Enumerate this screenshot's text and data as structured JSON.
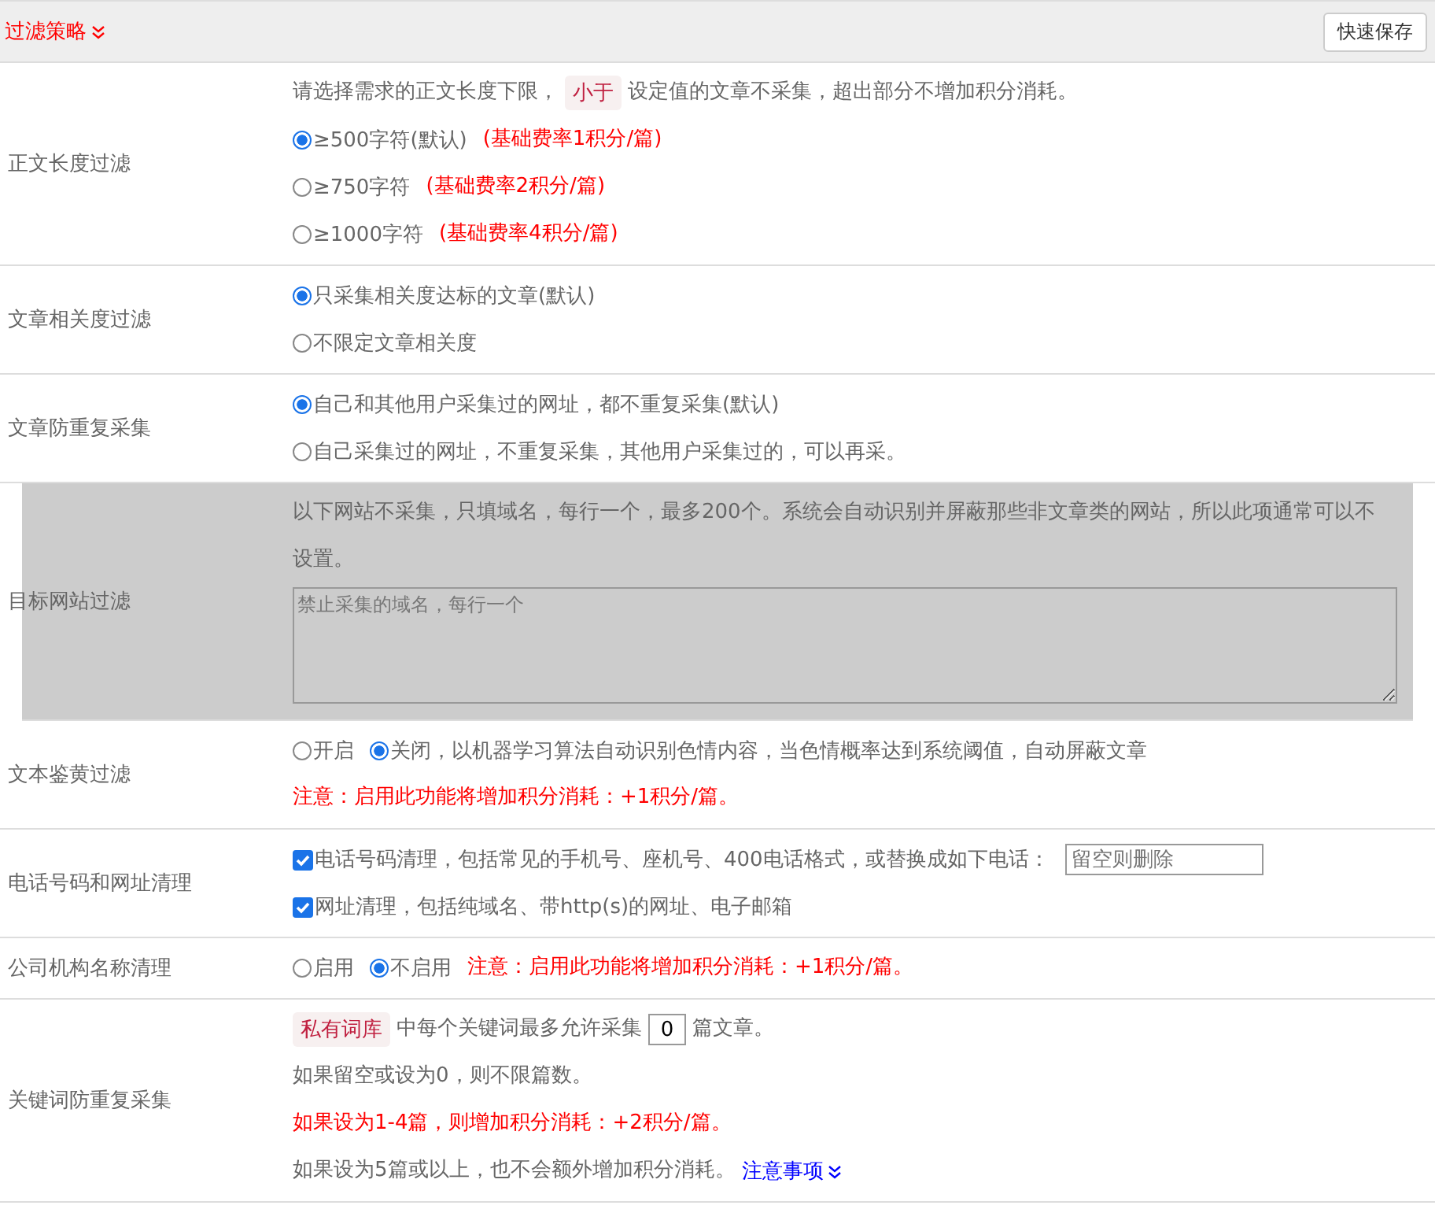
{
  "header": {
    "title": "过滤策略",
    "save_button": "快速保存"
  },
  "rows": [
    {
      "label": "正文长度过滤",
      "shaded": false,
      "lines": [
        [
          {
            "kind": "text",
            "text": "请选择需求的正文长度下限，"
          },
          {
            "kind": "tag",
            "text": "小于"
          },
          {
            "kind": "text",
            "text": "设定值的文章不采集，超出部分不增加积分消耗。"
          }
        ],
        [
          {
            "kind": "radio",
            "text": "≥500字符(默认)",
            "selected": true
          },
          {
            "kind": "warning",
            "text": "(基础费率1积分/篇)"
          }
        ],
        [
          {
            "kind": "radio",
            "text": "≥750字符",
            "selected": false
          },
          {
            "kind": "warning",
            "text": "(基础费率2积分/篇)"
          }
        ],
        [
          {
            "kind": "radio",
            "text": "≥1000字符",
            "selected": false
          },
          {
            "kind": "warning",
            "text": "(基础费率4积分/篇)"
          }
        ]
      ]
    },
    {
      "label": "文章相关度过滤",
      "shaded": false,
      "lines": [
        [
          {
            "kind": "radio",
            "text": "只采集相关度达标的文章(默认)",
            "selected": true
          }
        ],
        [
          {
            "kind": "radio",
            "text": "不限定文章相关度",
            "selected": false
          }
        ]
      ]
    },
    {
      "label": "文章防重复采集",
      "shaded": false,
      "lines": [
        [
          {
            "kind": "radio",
            "text": "自己和其他用户采集过的网址，都不重复采集(默认)",
            "selected": true
          }
        ],
        [
          {
            "kind": "radio",
            "text": "自己采集过的网址，不重复采集，其他用户采集过的，可以再采。",
            "selected": false
          }
        ]
      ]
    },
    {
      "label": "目标网站过滤",
      "shaded": true,
      "lines": [
        [
          {
            "kind": "text",
            "text": "以下网站不采集，只填域名，每行一个，最多200个。系统会自动识别并屏蔽那些非文章类的网站，所以此项通常可以不设置。"
          }
        ],
        [
          {
            "kind": "textarea",
            "placeholder": "禁止采集的域名，每行一个"
          }
        ]
      ]
    },
    {
      "label": "文本鉴黄过滤",
      "shaded": false,
      "lines": [
        [
          {
            "kind": "radio",
            "text": "开启",
            "selected": false
          },
          {
            "kind": "radio",
            "text": "关闭，以机器学习算法自动识别色情内容，当色情概率达到系统阈值，自动屏蔽文章",
            "selected": true
          }
        ],
        [
          {
            "kind": "warning",
            "text": "注意：启用此功能将增加积分消耗：+1积分/篇。"
          }
        ]
      ]
    },
    {
      "label": "电话号码和网址清理",
      "shaded": false,
      "lines": [
        [
          {
            "kind": "checkbox",
            "text": "电话号码清理，包括常见的手机号、座机号、400电话格式，或替换成如下电话：",
            "checked": true
          },
          {
            "kind": "input",
            "placeholder": "留空则删除"
          }
        ],
        [
          {
            "kind": "checkbox",
            "text": "网址清理，包括纯域名、带http(s)的网址、电子邮箱",
            "checked": true
          }
        ]
      ]
    },
    {
      "label": "公司机构名称清理",
      "shaded": false,
      "lines": [
        [
          {
            "kind": "radio",
            "text": "启用",
            "selected": false
          },
          {
            "kind": "radio",
            "text": "不启用",
            "selected": true
          },
          {
            "kind": "warning",
            "text": "注意：启用此功能将增加积分消耗：+1积分/篇。"
          }
        ]
      ]
    },
    {
      "label": "关键词防重复采集",
      "shaded": false,
      "lines": [
        [
          {
            "kind": "tag",
            "text": "私有词库"
          },
          {
            "kind": "text",
            "text": "中每个关键词最多允许采集"
          },
          {
            "kind": "number",
            "value": "0"
          },
          {
            "kind": "text",
            "text": "篇文章。"
          }
        ],
        [
          {
            "kind": "text",
            "text": "如果留空或设为0，则不限篇数。"
          }
        ],
        [
          {
            "kind": "warning",
            "text": "如果设为1-4篇，则增加积分消耗：+2积分/篇。"
          }
        ],
        [
          {
            "kind": "text",
            "text": "如果设为5篇或以上，也不会额外增加积分消耗。"
          },
          {
            "kind": "link",
            "text": "注意事项"
          }
        ]
      ]
    }
  ]
}
